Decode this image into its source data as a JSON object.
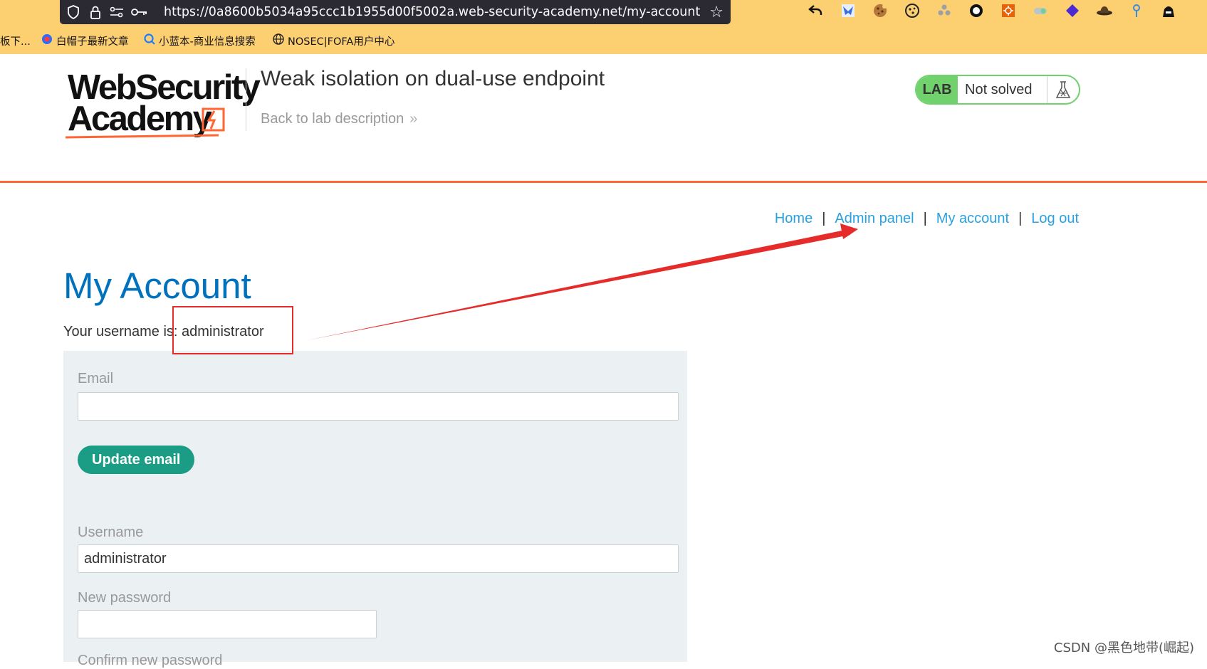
{
  "browser": {
    "url": "https://0a8600b5034a95ccc1b1955d00f5002a.web-security-academy.net/my-account",
    "bookmarks": [
      {
        "label": "板下...",
        "icon": "truncated-bookmark-icon"
      },
      {
        "label": "白帽子最新文章",
        "icon": "bookmark-site-icon"
      },
      {
        "label": "小蓝本-商业信息搜索",
        "icon": "search-circle-icon"
      },
      {
        "label": "NOSEC|FOFA用户中心",
        "icon": "globe-icon"
      }
    ],
    "extensions": [
      "back-icon",
      "ext-blue-icon",
      "cookie-icon",
      "cookie-editor-icon",
      "puzzle-icon",
      "circle-icon",
      "burp-icon",
      "toggle-icon",
      "diamond-icon",
      "hat-icon",
      "pin-icon",
      "hacker-icon"
    ]
  },
  "header": {
    "logo_line1": "WebSecurity",
    "logo_line2": "Academy",
    "lab_title": "Weak isolation on dual-use endpoint",
    "back_link": "Back to lab description",
    "back_chevron": "»",
    "lab_tag": "LAB",
    "lab_status": "Not solved"
  },
  "nav": {
    "home": "Home",
    "admin_panel": "Admin panel",
    "my_account": "My account",
    "log_out": "Log out",
    "separator": "|"
  },
  "main": {
    "heading": "My Account",
    "username_prefix": "Your username is: ",
    "username": "administrator",
    "email_label": "Email",
    "email_value": "",
    "update_email_button": "Update email",
    "username_label": "Username",
    "username_value": "administrator",
    "new_password_label": "New password",
    "new_password_value": "",
    "confirm_password_label": "Confirm new password"
  },
  "watermark": "CSDN @黑色地带(崛起)",
  "colors": {
    "chrome_bg": "#fcd071",
    "orange_accent": "#ff6633",
    "heading_blue": "#0071bc",
    "link_blue": "#29a1e0",
    "button_green": "#1b9d85",
    "lab_green": "#70d16d",
    "annotation_red": "#e62b2b"
  }
}
